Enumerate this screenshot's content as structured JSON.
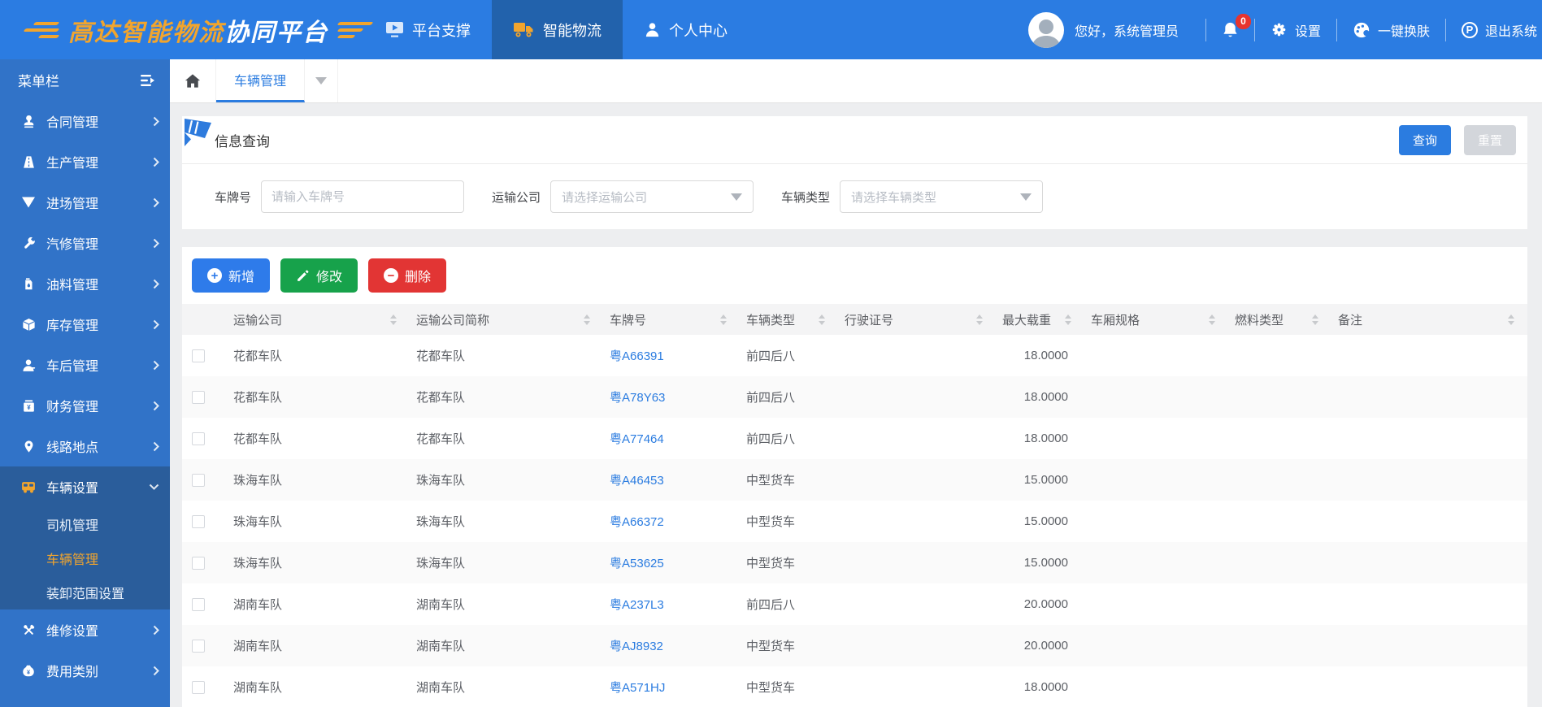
{
  "colors": {
    "header_blue": "#2b7ce2",
    "sidebar_blue": "#3173c8",
    "expanded_blue": "#2a5d9b",
    "accent_orange": "#f2a52d",
    "link_blue": "#2b7ce0",
    "green": "#17a24b",
    "red": "#e23534"
  },
  "header": {
    "logo_highlight": "高达智能物流",
    "logo_rest": "协同平台",
    "nav": [
      {
        "label": "平台支撑"
      },
      {
        "label": "智能物流"
      },
      {
        "label": "个人中心"
      }
    ],
    "greeting": "您好，系统管理员",
    "notification_count": "0",
    "settings_label": "设置",
    "skin_label": "一键换肤",
    "logout_label": "退出系统"
  },
  "sidebar": {
    "title": "菜单栏",
    "items": [
      {
        "label": "合同管理"
      },
      {
        "label": "生产管理"
      },
      {
        "label": "进场管理"
      },
      {
        "label": "汽修管理"
      },
      {
        "label": "油料管理"
      },
      {
        "label": "库存管理"
      },
      {
        "label": "车后管理"
      },
      {
        "label": "财务管理"
      },
      {
        "label": "线路地点"
      },
      {
        "label": "车辆设置"
      },
      {
        "label": "司机管理"
      },
      {
        "label": "车辆管理"
      },
      {
        "label": "装卸范围设置"
      },
      {
        "label": "维修设置"
      },
      {
        "label": "费用类别"
      }
    ]
  },
  "tabs": {
    "active_tab": "车辆管理"
  },
  "query": {
    "title": "信息查询",
    "search_button": "查询",
    "reset_button": "重置",
    "plate_label": "车牌号",
    "plate_placeholder": "请输入车牌号",
    "company_label": "运输公司",
    "company_placeholder": "请选择运输公司",
    "type_label": "车辆类型",
    "type_placeholder": "请选择车辆类型"
  },
  "toolbar": {
    "add": "新增",
    "edit": "修改",
    "delete": "删除"
  },
  "table": {
    "columns": [
      "运输公司",
      "运输公司简称",
      "车牌号",
      "车辆类型",
      "行驶证号",
      "最大载重",
      "车厢规格",
      "燃料类型",
      "备注"
    ],
    "rows": [
      {
        "company": "花都车队",
        "short_name": "花都车队",
        "plate": "粤A66391",
        "vehicle_type": "前四后八",
        "license_no": "",
        "max_load": "18.0000",
        "box_spec": "",
        "fuel_type": "",
        "note": ""
      },
      {
        "company": "花都车队",
        "short_name": "花都车队",
        "plate": "粤A78Y63",
        "vehicle_type": "前四后八",
        "license_no": "",
        "max_load": "18.0000",
        "box_spec": "",
        "fuel_type": "",
        "note": ""
      },
      {
        "company": "花都车队",
        "short_name": "花都车队",
        "plate": "粤A77464",
        "vehicle_type": "前四后八",
        "license_no": "",
        "max_load": "18.0000",
        "box_spec": "",
        "fuel_type": "",
        "note": ""
      },
      {
        "company": "珠海车队",
        "short_name": "珠海车队",
        "plate": "粤A46453",
        "vehicle_type": "中型货车",
        "license_no": "",
        "max_load": "15.0000",
        "box_spec": "",
        "fuel_type": "",
        "note": ""
      },
      {
        "company": "珠海车队",
        "short_name": "珠海车队",
        "plate": "粤A66372",
        "vehicle_type": "中型货车",
        "license_no": "",
        "max_load": "15.0000",
        "box_spec": "",
        "fuel_type": "",
        "note": ""
      },
      {
        "company": "珠海车队",
        "short_name": "珠海车队",
        "plate": "粤A53625",
        "vehicle_type": "中型货车",
        "license_no": "",
        "max_load": "15.0000",
        "box_spec": "",
        "fuel_type": "",
        "note": ""
      },
      {
        "company": "湖南车队",
        "short_name": "湖南车队",
        "plate": "粤A237L3",
        "vehicle_type": "前四后八",
        "license_no": "",
        "max_load": "20.0000",
        "box_spec": "",
        "fuel_type": "",
        "note": ""
      },
      {
        "company": "湖南车队",
        "short_name": "湖南车队",
        "plate": "粤AJ8932",
        "vehicle_type": "中型货车",
        "license_no": "",
        "max_load": "20.0000",
        "box_spec": "",
        "fuel_type": "",
        "note": ""
      },
      {
        "company": "湖南车队",
        "short_name": "湖南车队",
        "plate": "粤A571HJ",
        "vehicle_type": "中型货车",
        "license_no": "",
        "max_load": "18.0000",
        "box_spec": "",
        "fuel_type": "",
        "note": ""
      }
    ]
  }
}
